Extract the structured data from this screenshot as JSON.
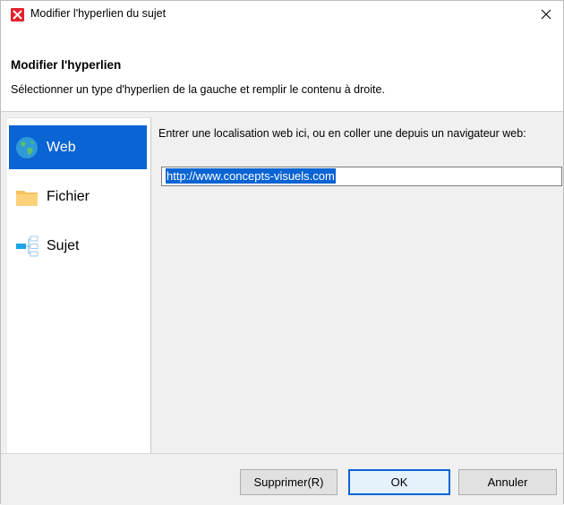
{
  "window": {
    "title": "Modifier l'hyperlien du sujet",
    "close_symbol": "✕"
  },
  "header": {
    "title": "Modifier l'hyperlien",
    "description": "Sélectionner un type d'hyperlien de la gauche et remplir le contenu à droite."
  },
  "sidebar": {
    "items": [
      {
        "label": "Web",
        "icon": "globe-icon",
        "selected": true
      },
      {
        "label": "Fichier",
        "icon": "folder-icon",
        "selected": false
      },
      {
        "label": "Sujet",
        "icon": "topic-icon",
        "selected": false
      }
    ]
  },
  "content": {
    "prompt": "Entrer une localisation web ici, ou en coller une depuis un navigateur web:",
    "url_value": "http://www.concepts-visuels.com"
  },
  "footer": {
    "delete_label": "Supprimer(R)",
    "ok_label": "OK",
    "cancel_label": "Annuler"
  },
  "colors": {
    "selection": "#0a64d3",
    "app_icon": "#e2202c",
    "folder": "#f7c25a"
  }
}
